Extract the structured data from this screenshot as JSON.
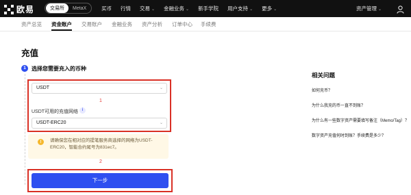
{
  "topbar": {
    "logo_text": "欧易",
    "switch": [
      "交易所",
      "MetaX"
    ],
    "menu": [
      {
        "label": "买币",
        "has_chevron": false
      },
      {
        "label": "行情",
        "has_chevron": false
      },
      {
        "label": "交易",
        "has_chevron": true
      },
      {
        "label": "金融业务",
        "has_chevron": true
      },
      {
        "label": "新手学院",
        "has_chevron": false
      },
      {
        "label": "用户支持",
        "has_chevron": true
      },
      {
        "label": "更多",
        "has_chevron": true
      }
    ],
    "asset_mgmt": "资产管理",
    "chevron": "⌄",
    "user_icon": "user-icon"
  },
  "subnav": {
    "tabs": [
      "资产总览",
      "资金账户",
      "交易账户",
      "金融业务",
      "资产分析",
      "订单中心",
      "手续费"
    ],
    "active": 1
  },
  "page": {
    "title": "充值",
    "step_number": "1",
    "step_title": "选择您需要充入的币种",
    "coin_value": "USDT",
    "network_label": "USDT可用的充值网络",
    "info_glyph": "i",
    "network_value": "USDT-ERC20",
    "annot_1": "1",
    "annot_2": "2",
    "warn_glyph": "!",
    "warning": "请确保您在相对应的提笔服务商选择的网络为USDT-ERC20，智能合约尾号为831ec7。",
    "next_button": "下一步"
  },
  "faq": {
    "title": "相关问题",
    "items": [
      "如何充币？",
      "为什么我充的币一直不到账？",
      "为什么有一些数字资产需要填写备注（Memo/Tag）？",
      "数字资产充值何时到账？手续费是多少？"
    ]
  },
  "colors": {
    "accent": "#2e4ff0",
    "annotation_red": "#d93025",
    "topbar_bg": "#111111",
    "warning_bg": "#fff8e6"
  }
}
